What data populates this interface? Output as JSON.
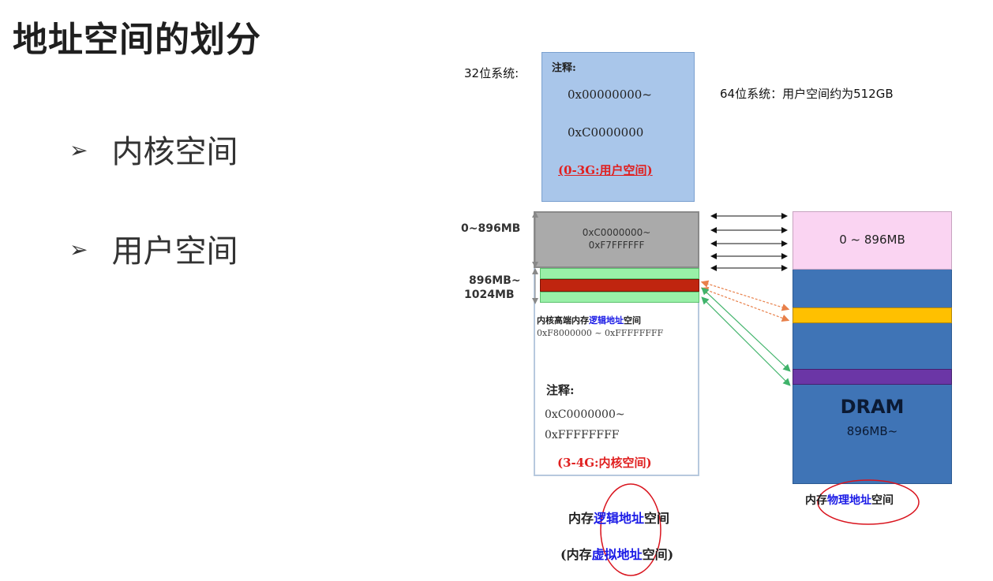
{
  "title": "地址空间的划分",
  "bullets": [
    {
      "marker": "➢",
      "text": "内核空间"
    },
    {
      "marker": "➢",
      "text": "用户空间"
    }
  ],
  "labels": {
    "sys32": "32位系统:",
    "sys64": "64位系统：用户空间约为512GB"
  },
  "user_box": {
    "note": "注释:",
    "addr_start": "0x00000000~",
    "addr_end": "0xC0000000",
    "range_label": "(0-3G:用户空间)"
  },
  "kernel_region": {
    "low_label": "0~896MB",
    "low_start": "0xC0000000~",
    "low_end": "0xF7FFFFFF",
    "high_label_1": "896MB~",
    "high_label_2": "1024MB",
    "high_desc_pre": "内核高端内存",
    "high_desc_hl": "逻辑地址",
    "high_desc_post": "空间",
    "high_range": "0xF8000000 ~ 0xFFFFFFFF",
    "note": "注释:",
    "addr_start": "0xC0000000~",
    "addr_end": "0xFFFFFFFF",
    "range_label": "(3-4G:内核空间)"
  },
  "dram": {
    "low_block": "0 ~ 896MB",
    "title": "DRAM",
    "sub": "896MB~"
  },
  "captions": {
    "physical_pre": "内存",
    "physical_hl": "物理地址",
    "physical_post": "空间",
    "logical_pre": "内存",
    "logical_hl": "逻辑地址",
    "logical_post": "空间",
    "virtual_pre": "(内存",
    "virtual_hl": "虚拟地址",
    "virtual_post": "空间)"
  },
  "colors": {
    "user_box_bg": "#a9c6ea",
    "kernel_low_bg": "#aaaaaa",
    "green_band": "#99f0a8",
    "red_band": "#c0250f",
    "dram_low_bg": "#fad4f2",
    "dram_bg": "#3f74b6",
    "orange_band": "#ffc000",
    "purple_band": "#6b36a6",
    "highlight_blue": "#1a1ae6",
    "highlight_red": "#e02020",
    "circle_red": "#d9141e"
  }
}
